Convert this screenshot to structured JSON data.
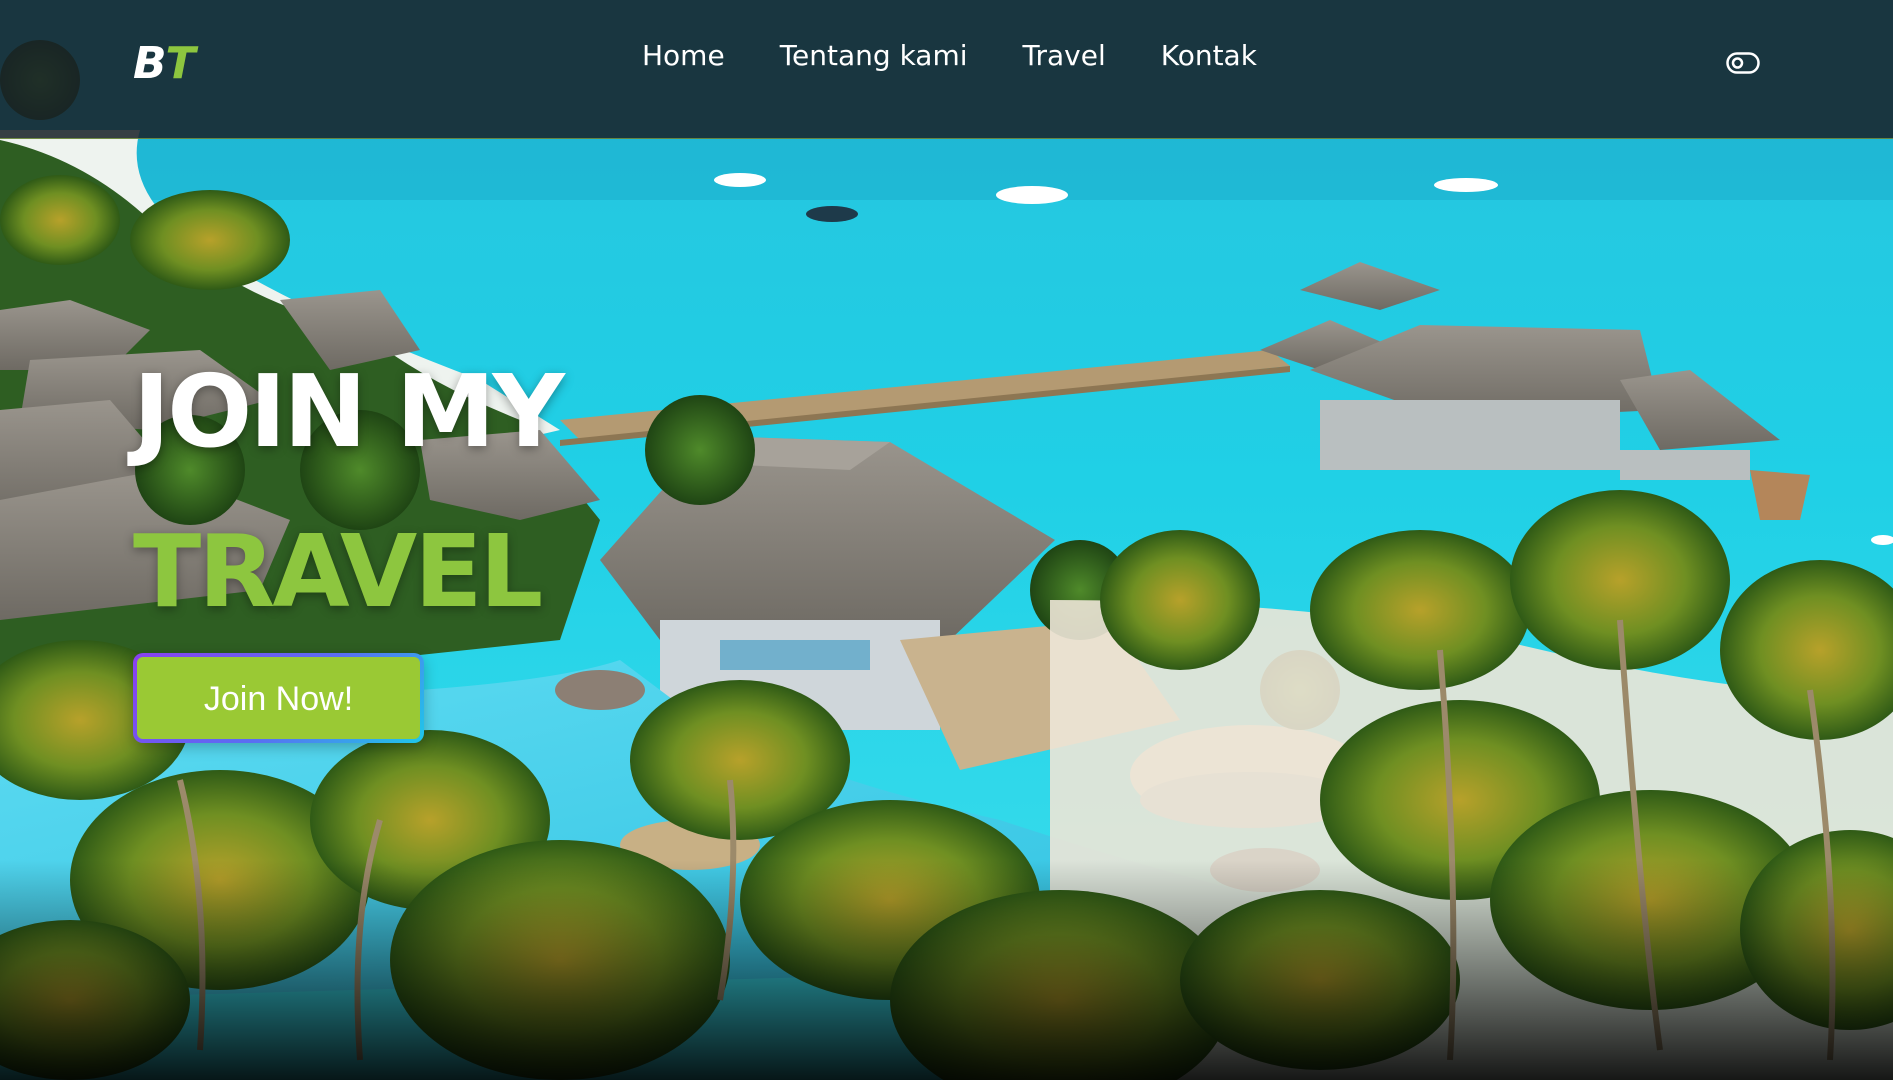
{
  "brand": {
    "logo_b": "B",
    "logo_t": "T",
    "accent_color": "#8dc63f"
  },
  "nav": {
    "items": [
      {
        "label": "Home"
      },
      {
        "label": "Tentang kami"
      },
      {
        "label": "Travel"
      },
      {
        "label": "Kontak"
      }
    ],
    "toggle_icon": "theme-toggle-icon"
  },
  "hero": {
    "title_line1": "JOIN MY",
    "title_line2": "TRAVEL",
    "cta_label": "Join Now!",
    "background": "aerial-tropical-resort-photo",
    "colors": {
      "title_primary": "#ffffff",
      "title_accent": "#8dc63f",
      "button_fill": "#9ac934",
      "button_border_start": "#8a3ff0",
      "button_border_end": "#1ec8e8",
      "navbar_bg": "#192128"
    }
  }
}
